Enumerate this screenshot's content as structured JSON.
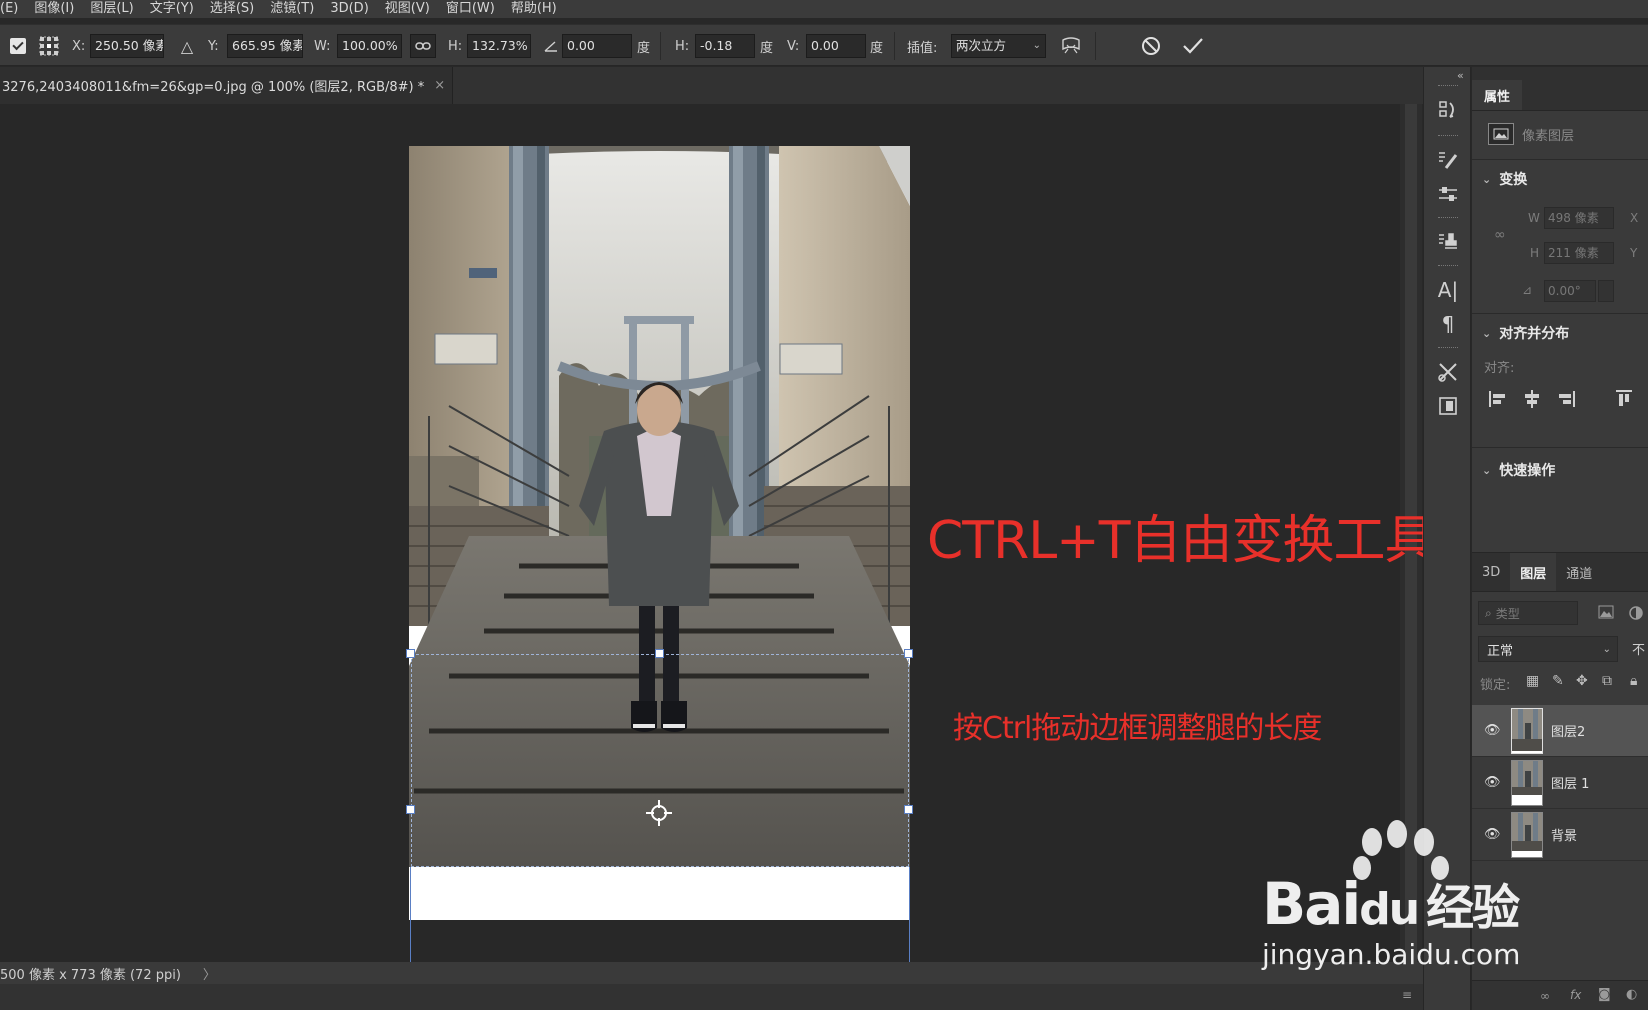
{
  "menu": [
    "(E)",
    "图像(I)",
    "图层(L)",
    "文字(Y)",
    "选择(S)",
    "滤镜(T)",
    "3D(D)",
    "视图(V)",
    "窗口(W)",
    "帮助(H)"
  ],
  "options": {
    "x_label": "X:",
    "x_value": "250.50 像素",
    "y_label": "Y:",
    "y_value": "665.95 像素",
    "w_label": "W:",
    "w_value": "100.00%",
    "h_label": "H:",
    "h_value": "132.73%",
    "angle_value": "0.00",
    "deg1": "度",
    "hskew_label": "H:",
    "hskew_value": "-0.18",
    "deg2": "度",
    "vskew_label": "V:",
    "vskew_value": "0.00",
    "deg3": "度",
    "interp_label": "插值:",
    "interp_value": "两次立方"
  },
  "doc_tab": {
    "title": "3276,2403408011&fm=26&gp=0.jpg @ 100% (图层2, RGB/8#) *",
    "close": "×"
  },
  "annotations": {
    "main": "CTRL+T自由变换工具",
    "sub": "按Ctrl拖动边框调整腿的长度"
  },
  "status": {
    "text": "500 像素 x 773 像素 (72 ppi)",
    "arrow": "〉"
  },
  "properties": {
    "tab": "属性",
    "layer_type": "像素图层",
    "transform_title": "变换",
    "w_label": "W",
    "w_value": "498 像素",
    "x_label": "X",
    "h_label": "H",
    "h_value": "211 像素",
    "y_label": "Y",
    "angle_value": "0.00°",
    "align_title": "对齐并分布",
    "align_label": "对齐:",
    "quick_title": "快速操作"
  },
  "layers_panel": {
    "tabs": [
      "3D",
      "图层",
      "通道"
    ],
    "filter_placeholder": "类型",
    "blend_mode": "正常",
    "opacity_cut": "不",
    "lock_label": "锁定:",
    "layers": [
      {
        "name": "图层2",
        "selected": true
      },
      {
        "name": "图层 1",
        "selected": false
      },
      {
        "name": "背景",
        "selected": false
      }
    ]
  },
  "watermark": {
    "brand": "Bai",
    "brand2": "du",
    "cn": "经验",
    "url": "jingyan.baidu.com"
  }
}
